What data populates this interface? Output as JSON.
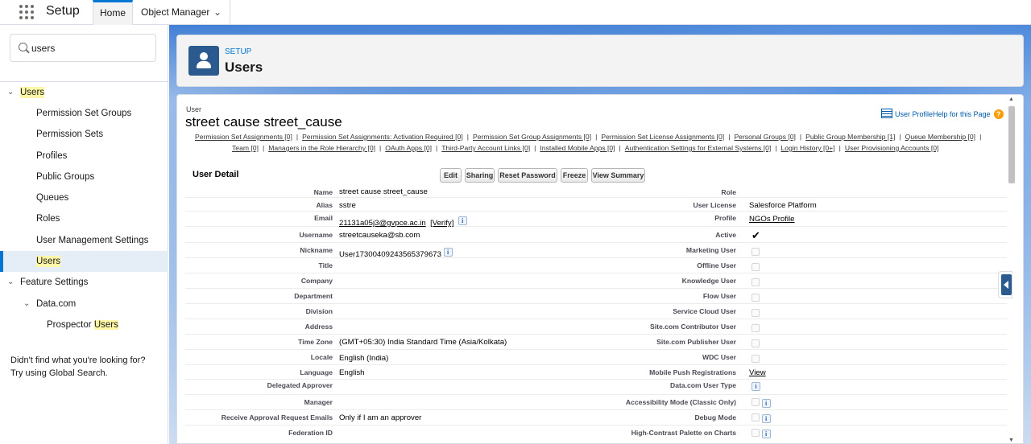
{
  "app": {
    "title": "Setup"
  },
  "tabs": {
    "home": "Home",
    "object_manager": "Object Manager"
  },
  "search": {
    "value": "users"
  },
  "sidebar": {
    "users_group": "Users",
    "items": [
      "Permission Set Groups",
      "Permission Sets",
      "Profiles",
      "Public Groups",
      "Queues",
      "Roles",
      "User Management Settings"
    ],
    "users_item": "Users",
    "feature_settings": "Feature Settings",
    "datacom": "Data.com",
    "prospector_prefix": "Prospector ",
    "prospector_hl": "Users",
    "help1": "Didn't find what you're looking for?",
    "help2": "Try using Global Search."
  },
  "header": {
    "setup_label": "SETUP",
    "title": "Users"
  },
  "record": {
    "type_label": "User",
    "name": "street cause street_cause",
    "help_link": "User ProfileHelp for this Page",
    "help_q": "?"
  },
  "related_lists_row1": [
    "Permission Set Assignments [0]",
    "Permission Set Assignments: Activation Required [0]",
    "Permission Set Group Assignments [0]",
    "Permission Set License Assignments [0]",
    "Personal Groups [0]",
    "Public Group Membership [1]",
    "Queue Membership [0]"
  ],
  "related_lists_row2": [
    "Team [0]",
    "Managers in the Role Hierarchy [0]",
    "OAuth Apps [0]",
    "Third-Party Account Links [0]",
    "Installed Mobile Apps [0]",
    "Authentication Settings for External Systems [0]",
    "Login History [0+]",
    "User Provisioning Accounts [0]"
  ],
  "detail": {
    "title": "User Detail",
    "buttons": {
      "edit": "Edit",
      "sharing": "Sharing",
      "reset": "Reset Password",
      "freeze": "Freeze",
      "summary": "View Summary"
    }
  },
  "fields_left": {
    "name_l": "Name",
    "name_v": "street cause street_cause",
    "alias_l": "Alias",
    "alias_v": "sstre",
    "email_l": "Email",
    "email_v": "21131a05j3@gvpce.ac.in",
    "verify": "[Verify]",
    "username_l": "Username",
    "username_v": "streetcauseka@sb.com",
    "nickname_l": "Nickname",
    "nickname_v": "User17300409243565379673",
    "title_l": "Title",
    "company_l": "Company",
    "department_l": "Department",
    "division_l": "Division",
    "address_l": "Address",
    "timezone_l": "Time Zone",
    "timezone_v": "(GMT+05:30) India Standard Time (Asia/Kolkata)",
    "locale_l": "Locale",
    "locale_v": "English (India)",
    "language_l": "Language",
    "language_v": "English",
    "delegated_l": "Delegated Approver",
    "manager_l": "Manager",
    "approval_l": "Receive Approval Request Emails",
    "approval_v": "Only if I am an approver",
    "federation_l": "Federation ID"
  },
  "fields_right": {
    "role_l": "Role",
    "license_l": "User License",
    "license_v": "Salesforce Platform",
    "profile_l": "Profile",
    "profile_v": "NGOs Profile",
    "active_l": "Active",
    "active_v": "✔",
    "marketing_l": "Marketing User",
    "offline_l": "Offline User",
    "knowledge_l": "Knowledge User",
    "flow_l": "Flow User",
    "service_l": "Service Cloud User",
    "sitecontrib_l": "Site.com Contributor User",
    "sitepub_l": "Site.com Publisher User",
    "wdc_l": "WDC User",
    "mobilepush_l": "Mobile Push Registrations",
    "mobilepush_v": "View",
    "datacom_l": "Data.com User Type",
    "access_l": "Accessibility Mode (Classic Only)",
    "debug_l": "Debug Mode",
    "contrast_l": "High-Contrast Palette on Charts"
  },
  "icons": {
    "info": "i"
  }
}
